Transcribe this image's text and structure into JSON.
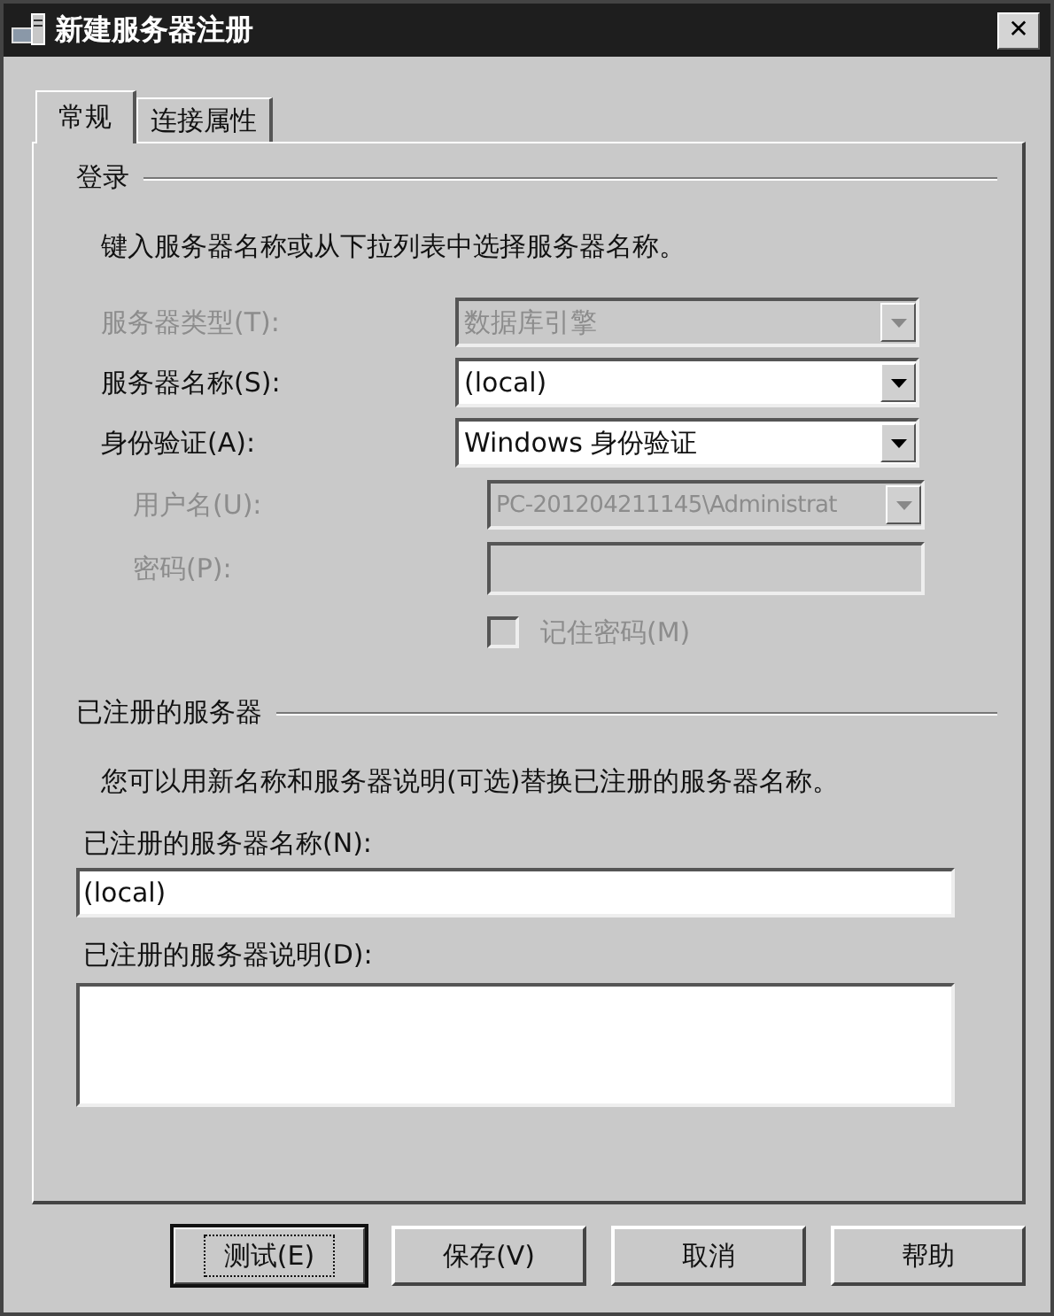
{
  "window": {
    "title": "新建服务器注册",
    "close": "✕"
  },
  "tabs": [
    {
      "label": "常规",
      "selected": true
    },
    {
      "label": "连接属性",
      "selected": false
    }
  ],
  "login": {
    "heading": "登录",
    "description": "键入服务器名称或从下拉列表中选择服务器名称。",
    "fields": [
      {
        "kind": "combo",
        "label": "服务器类型(T):",
        "value": "数据库引擎",
        "disabled": true
      },
      {
        "kind": "combo",
        "label": "服务器名称(S):",
        "value": "(local)",
        "disabled": false
      },
      {
        "kind": "combo",
        "label": "身份验证(A):",
        "value": "Windows 身份验证",
        "disabled": false,
        "children": [
          {
            "kind": "combo",
            "label": "用户名(U):",
            "value": "PC-201204211145\\Administrat",
            "disabled": true
          },
          {
            "kind": "text",
            "label": "密码(P):",
            "disabled": true
          },
          {
            "kind": "checkbox",
            "label": "记住密码(M)",
            "checked": false,
            "disabled": true
          }
        ]
      }
    ]
  },
  "registered": {
    "heading": "已注册的服务器",
    "description": "您可以用新名称和服务器说明(可选)替换已注册的服务器名称。",
    "name_label": "已注册的服务器名称(N):",
    "name_value": "(local)",
    "desc_label": "已注册的服务器说明(D):"
  },
  "buttons": [
    {
      "label": "测试(E)",
      "focused": true
    },
    {
      "label": "保存(V)",
      "focused": false
    },
    {
      "label": "取消",
      "focused": false
    },
    {
      "label": "帮助",
      "focused": false
    }
  ]
}
